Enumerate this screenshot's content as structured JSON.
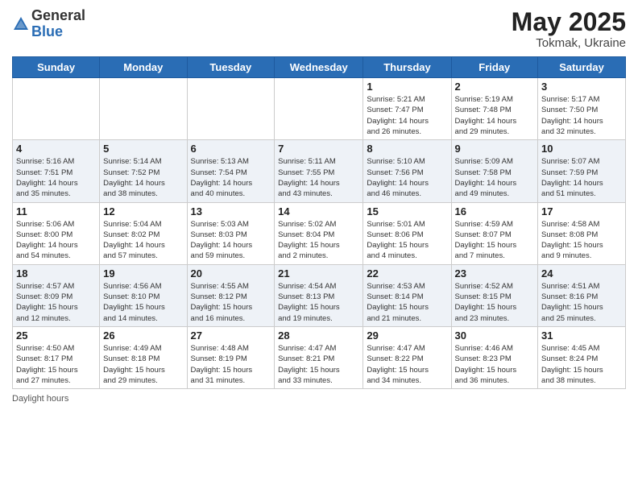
{
  "logo": {
    "general": "General",
    "blue": "Blue"
  },
  "title": "May 2025",
  "subtitle": "Tokmak, Ukraine",
  "days_of_week": [
    "Sunday",
    "Monday",
    "Tuesday",
    "Wednesday",
    "Thursday",
    "Friday",
    "Saturday"
  ],
  "weeks": [
    [
      {
        "day": "",
        "info": ""
      },
      {
        "day": "",
        "info": ""
      },
      {
        "day": "",
        "info": ""
      },
      {
        "day": "",
        "info": ""
      },
      {
        "day": "1",
        "info": "Sunrise: 5:21 AM\nSunset: 7:47 PM\nDaylight: 14 hours\nand 26 minutes."
      },
      {
        "day": "2",
        "info": "Sunrise: 5:19 AM\nSunset: 7:48 PM\nDaylight: 14 hours\nand 29 minutes."
      },
      {
        "day": "3",
        "info": "Sunrise: 5:17 AM\nSunset: 7:50 PM\nDaylight: 14 hours\nand 32 minutes."
      }
    ],
    [
      {
        "day": "4",
        "info": "Sunrise: 5:16 AM\nSunset: 7:51 PM\nDaylight: 14 hours\nand 35 minutes."
      },
      {
        "day": "5",
        "info": "Sunrise: 5:14 AM\nSunset: 7:52 PM\nDaylight: 14 hours\nand 38 minutes."
      },
      {
        "day": "6",
        "info": "Sunrise: 5:13 AM\nSunset: 7:54 PM\nDaylight: 14 hours\nand 40 minutes."
      },
      {
        "day": "7",
        "info": "Sunrise: 5:11 AM\nSunset: 7:55 PM\nDaylight: 14 hours\nand 43 minutes."
      },
      {
        "day": "8",
        "info": "Sunrise: 5:10 AM\nSunset: 7:56 PM\nDaylight: 14 hours\nand 46 minutes."
      },
      {
        "day": "9",
        "info": "Sunrise: 5:09 AM\nSunset: 7:58 PM\nDaylight: 14 hours\nand 49 minutes."
      },
      {
        "day": "10",
        "info": "Sunrise: 5:07 AM\nSunset: 7:59 PM\nDaylight: 14 hours\nand 51 minutes."
      }
    ],
    [
      {
        "day": "11",
        "info": "Sunrise: 5:06 AM\nSunset: 8:00 PM\nDaylight: 14 hours\nand 54 minutes."
      },
      {
        "day": "12",
        "info": "Sunrise: 5:04 AM\nSunset: 8:02 PM\nDaylight: 14 hours\nand 57 minutes."
      },
      {
        "day": "13",
        "info": "Sunrise: 5:03 AM\nSunset: 8:03 PM\nDaylight: 14 hours\nand 59 minutes."
      },
      {
        "day": "14",
        "info": "Sunrise: 5:02 AM\nSunset: 8:04 PM\nDaylight: 15 hours\nand 2 minutes."
      },
      {
        "day": "15",
        "info": "Sunrise: 5:01 AM\nSunset: 8:06 PM\nDaylight: 15 hours\nand 4 minutes."
      },
      {
        "day": "16",
        "info": "Sunrise: 4:59 AM\nSunset: 8:07 PM\nDaylight: 15 hours\nand 7 minutes."
      },
      {
        "day": "17",
        "info": "Sunrise: 4:58 AM\nSunset: 8:08 PM\nDaylight: 15 hours\nand 9 minutes."
      }
    ],
    [
      {
        "day": "18",
        "info": "Sunrise: 4:57 AM\nSunset: 8:09 PM\nDaylight: 15 hours\nand 12 minutes."
      },
      {
        "day": "19",
        "info": "Sunrise: 4:56 AM\nSunset: 8:10 PM\nDaylight: 15 hours\nand 14 minutes."
      },
      {
        "day": "20",
        "info": "Sunrise: 4:55 AM\nSunset: 8:12 PM\nDaylight: 15 hours\nand 16 minutes."
      },
      {
        "day": "21",
        "info": "Sunrise: 4:54 AM\nSunset: 8:13 PM\nDaylight: 15 hours\nand 19 minutes."
      },
      {
        "day": "22",
        "info": "Sunrise: 4:53 AM\nSunset: 8:14 PM\nDaylight: 15 hours\nand 21 minutes."
      },
      {
        "day": "23",
        "info": "Sunrise: 4:52 AM\nSunset: 8:15 PM\nDaylight: 15 hours\nand 23 minutes."
      },
      {
        "day": "24",
        "info": "Sunrise: 4:51 AM\nSunset: 8:16 PM\nDaylight: 15 hours\nand 25 minutes."
      }
    ],
    [
      {
        "day": "25",
        "info": "Sunrise: 4:50 AM\nSunset: 8:17 PM\nDaylight: 15 hours\nand 27 minutes."
      },
      {
        "day": "26",
        "info": "Sunrise: 4:49 AM\nSunset: 8:18 PM\nDaylight: 15 hours\nand 29 minutes."
      },
      {
        "day": "27",
        "info": "Sunrise: 4:48 AM\nSunset: 8:19 PM\nDaylight: 15 hours\nand 31 minutes."
      },
      {
        "day": "28",
        "info": "Sunrise: 4:47 AM\nSunset: 8:21 PM\nDaylight: 15 hours\nand 33 minutes."
      },
      {
        "day": "29",
        "info": "Sunrise: 4:47 AM\nSunset: 8:22 PM\nDaylight: 15 hours\nand 34 minutes."
      },
      {
        "day": "30",
        "info": "Sunrise: 4:46 AM\nSunset: 8:23 PM\nDaylight: 15 hours\nand 36 minutes."
      },
      {
        "day": "31",
        "info": "Sunrise: 4:45 AM\nSunset: 8:24 PM\nDaylight: 15 hours\nand 38 minutes."
      }
    ]
  ],
  "footer": "Daylight hours"
}
